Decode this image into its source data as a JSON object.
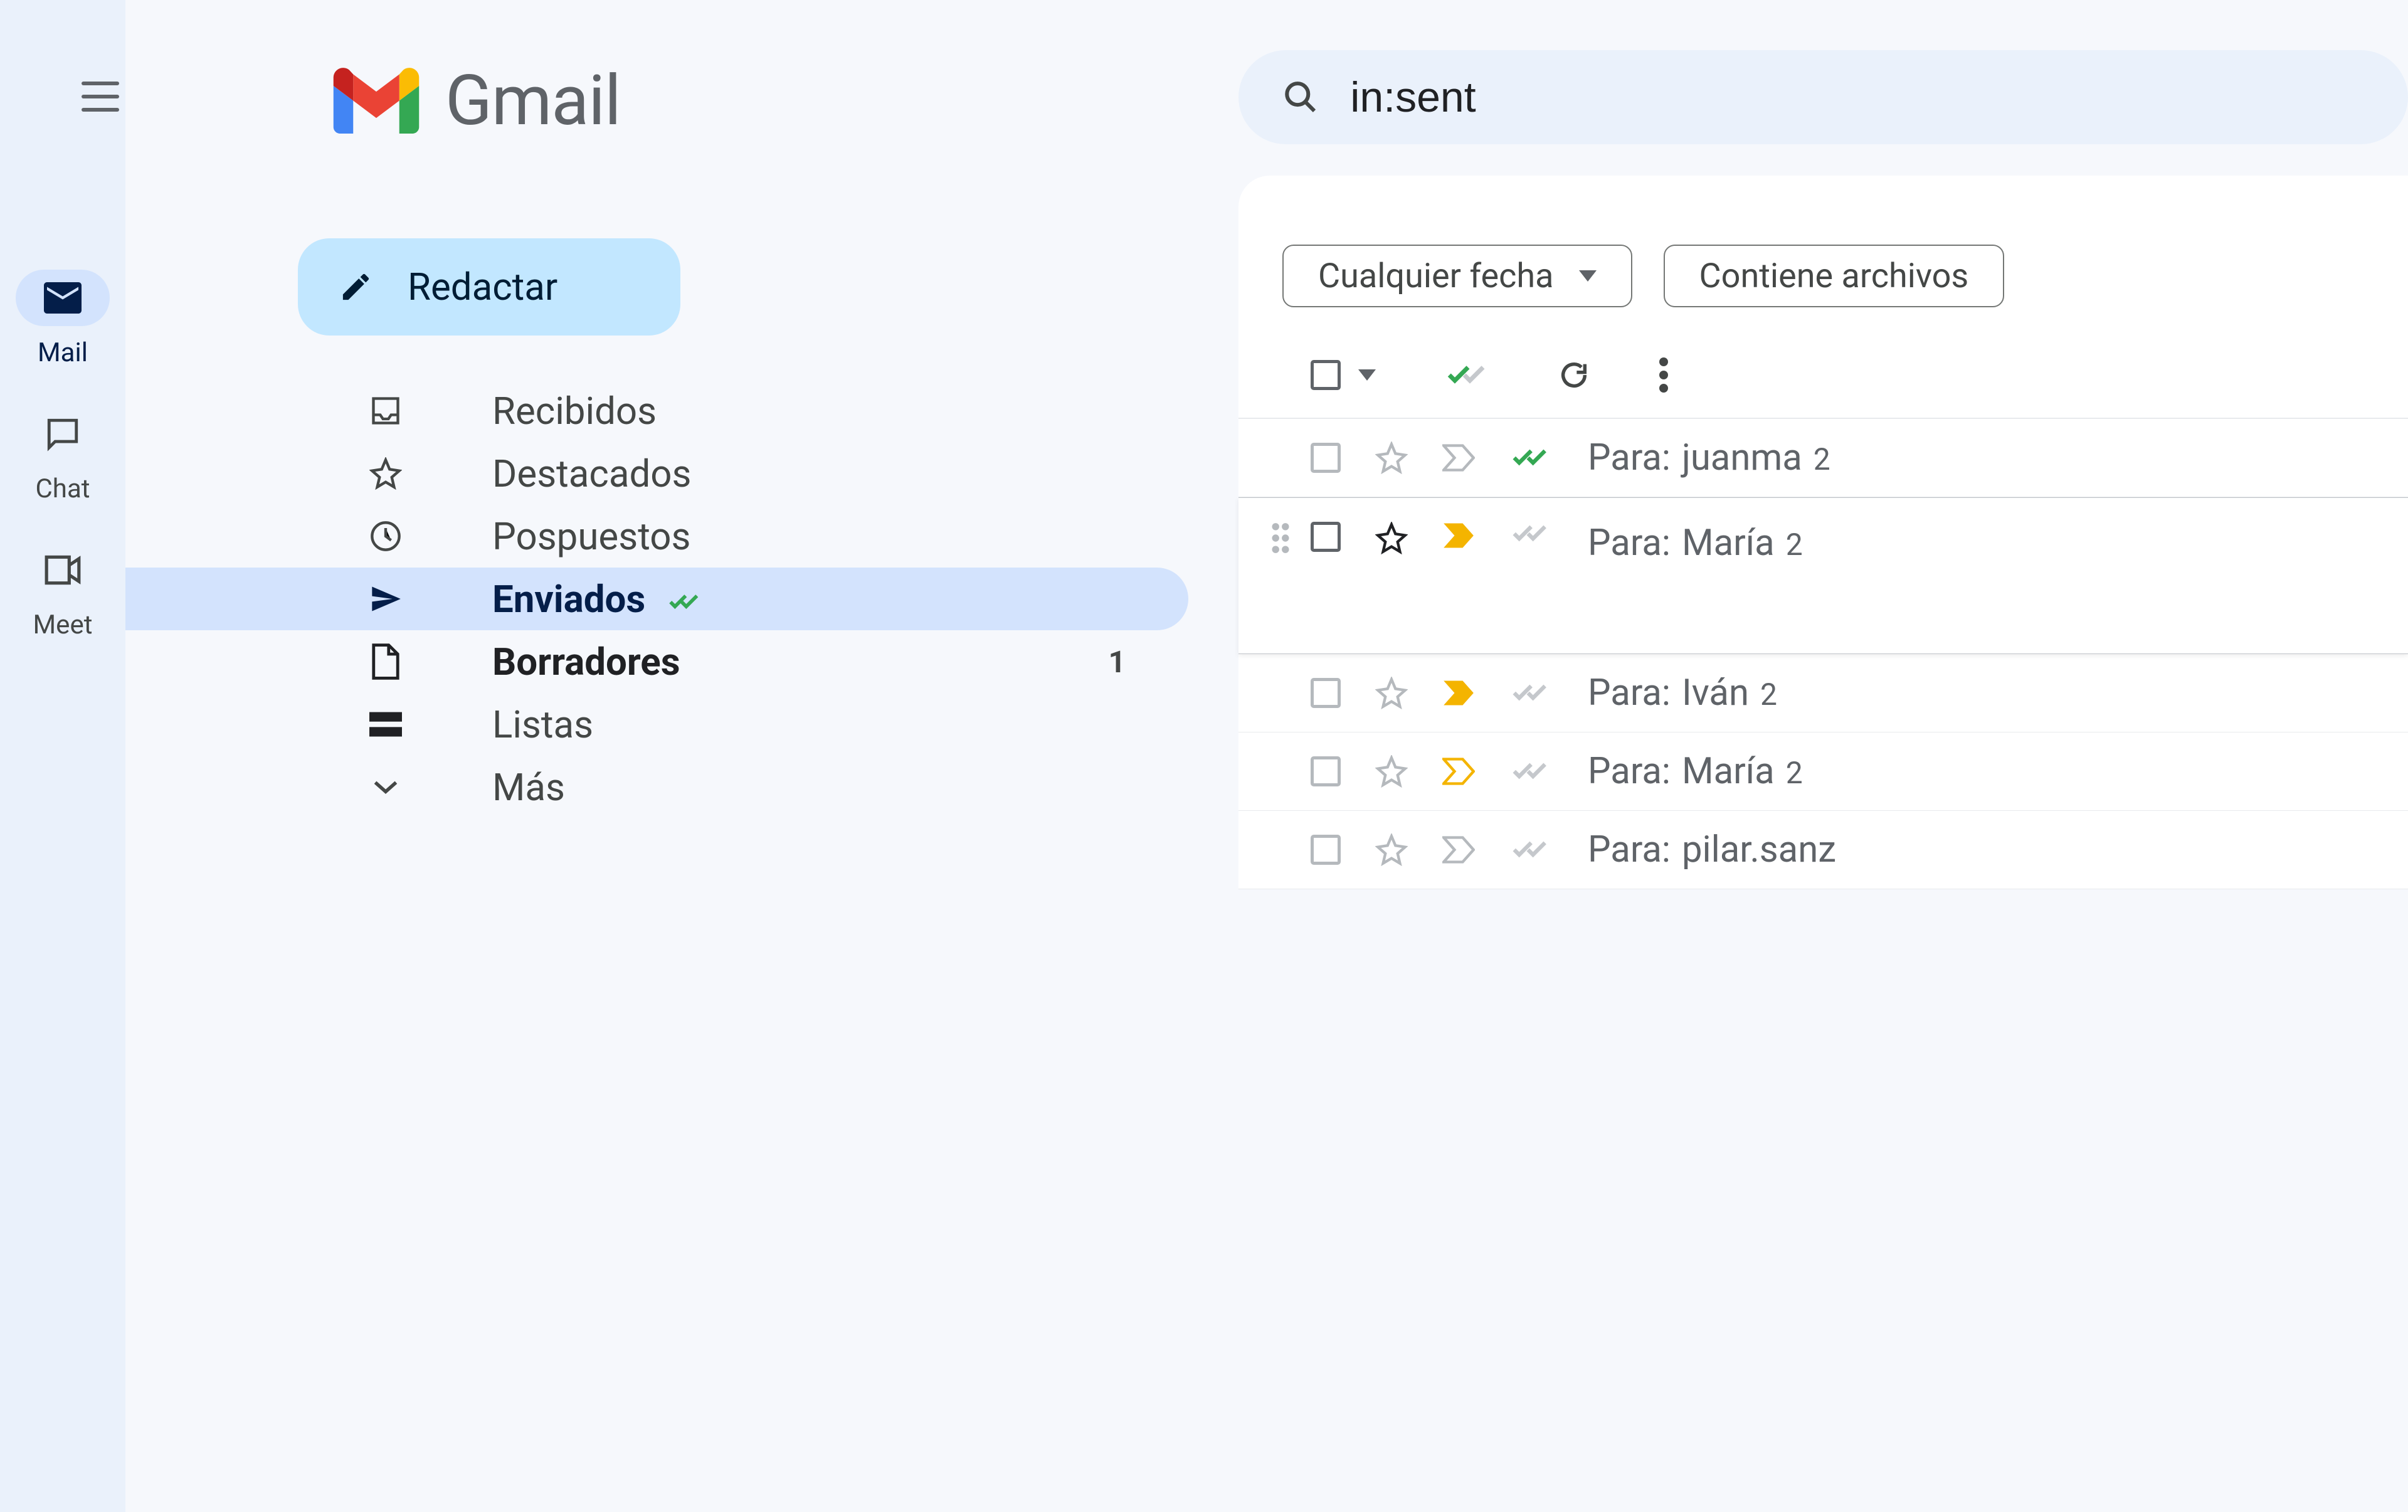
{
  "app_rail": {
    "items": [
      {
        "label": "Mail",
        "icon": "mail"
      },
      {
        "label": "Chat",
        "icon": "chat"
      },
      {
        "label": "Meet",
        "icon": "meet"
      }
    ]
  },
  "header": {
    "product_name": "Gmail",
    "search_value": "in:sent"
  },
  "compose_label": "Redactar",
  "sidebar": {
    "items": [
      {
        "label": "Recibidos",
        "icon": "inbox"
      },
      {
        "label": "Destacados",
        "icon": "star"
      },
      {
        "label": "Pospuestos",
        "icon": "clock"
      },
      {
        "label": "Enviados",
        "icon": "send",
        "selected": true,
        "read_receipt": true
      },
      {
        "label": "Borradores",
        "icon": "draft",
        "bold": true,
        "count": "1"
      },
      {
        "label": "Listas",
        "icon": "stack"
      },
      {
        "label": "Más",
        "icon": "expand"
      }
    ]
  },
  "filters": {
    "date": "Cualquier fecha",
    "attachments": "Contiene archivos"
  },
  "recipient_prefix": "Para:",
  "emails": [
    {
      "name": "juanma",
      "count": "2",
      "status": "read-green",
      "importance": "none",
      "starred": false
    },
    {
      "name": "María",
      "count": "2",
      "status": "unread-gray",
      "importance": "yellow-filled",
      "starred": false,
      "hovered": true
    },
    {
      "name": "Iván",
      "count": "2",
      "status": "unread-gray",
      "importance": "yellow-filled",
      "starred": false
    },
    {
      "name": "María",
      "count": "2",
      "status": "unread-gray",
      "importance": "yellow-hollow",
      "starred": false
    },
    {
      "name": "pilar.sanz",
      "count": "",
      "status": "unread-gray",
      "importance": "none",
      "starred": false
    }
  ]
}
